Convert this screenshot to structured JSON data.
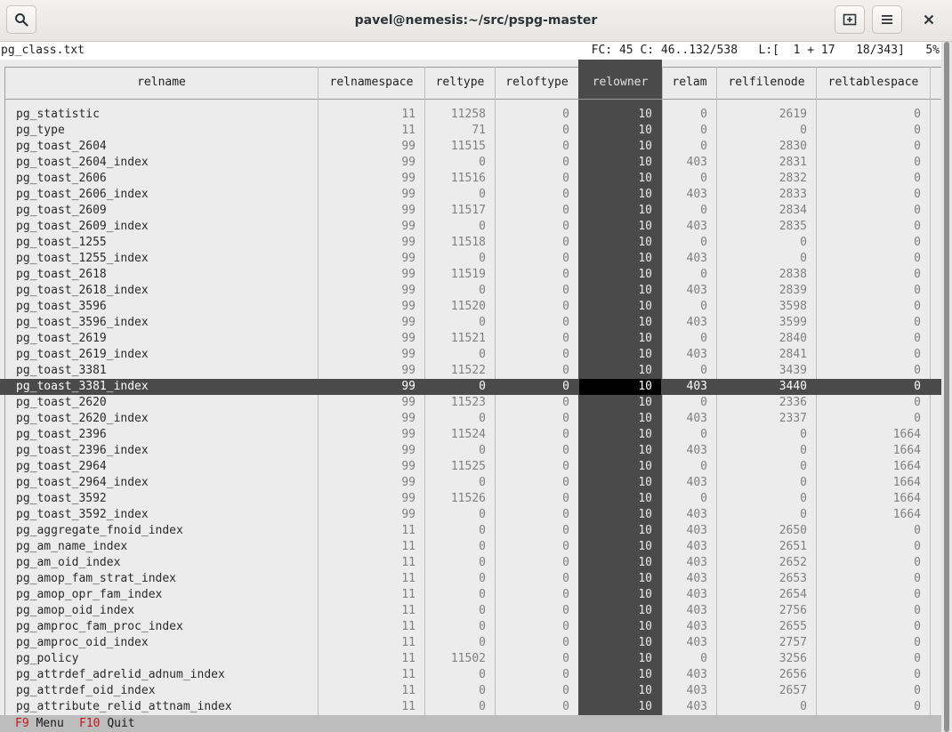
{
  "window": {
    "title": "pavel@nemesis:~/src/pspg-master",
    "search_icon": "search-icon",
    "new_tab_icon": "new-tab-icon",
    "menu_icon": "hamburger-menu-icon",
    "close_icon": "close-icon"
  },
  "status": {
    "filename": "pg_class.txt",
    "position": "FC: 45 C: 46..132/538   L:[  1 + 17   18/343]   5%"
  },
  "colors": {
    "cursor_row": "#4a4a4a",
    "highlighted_column": "#4a4a4a",
    "function_key": "#c01818"
  },
  "table": {
    "columns": [
      "relname",
      "relnamespace",
      "reltype",
      "reloftype",
      "relowner",
      "relam",
      "relfilenode",
      "reltablespace"
    ],
    "cursor_row_index": 17,
    "highlighted_column": "relowner",
    "rows": [
      [
        "pg_statistic",
        "11",
        "11258",
        "0",
        "10",
        "0",
        "2619",
        "0"
      ],
      [
        "pg_type",
        "11",
        "71",
        "0",
        "10",
        "0",
        "0",
        "0"
      ],
      [
        "pg_toast_2604",
        "99",
        "11515",
        "0",
        "10",
        "0",
        "2830",
        "0"
      ],
      [
        "pg_toast_2604_index",
        "99",
        "0",
        "0",
        "10",
        "403",
        "2831",
        "0"
      ],
      [
        "pg_toast_2606",
        "99",
        "11516",
        "0",
        "10",
        "0",
        "2832",
        "0"
      ],
      [
        "pg_toast_2606_index",
        "99",
        "0",
        "0",
        "10",
        "403",
        "2833",
        "0"
      ],
      [
        "pg_toast_2609",
        "99",
        "11517",
        "0",
        "10",
        "0",
        "2834",
        "0"
      ],
      [
        "pg_toast_2609_index",
        "99",
        "0",
        "0",
        "10",
        "403",
        "2835",
        "0"
      ],
      [
        "pg_toast_1255",
        "99",
        "11518",
        "0",
        "10",
        "0",
        "0",
        "0"
      ],
      [
        "pg_toast_1255_index",
        "99",
        "0",
        "0",
        "10",
        "403",
        "0",
        "0"
      ],
      [
        "pg_toast_2618",
        "99",
        "11519",
        "0",
        "10",
        "0",
        "2838",
        "0"
      ],
      [
        "pg_toast_2618_index",
        "99",
        "0",
        "0",
        "10",
        "403",
        "2839",
        "0"
      ],
      [
        "pg_toast_3596",
        "99",
        "11520",
        "0",
        "10",
        "0",
        "3598",
        "0"
      ],
      [
        "pg_toast_3596_index",
        "99",
        "0",
        "0",
        "10",
        "403",
        "3599",
        "0"
      ],
      [
        "pg_toast_2619",
        "99",
        "11521",
        "0",
        "10",
        "0",
        "2840",
        "0"
      ],
      [
        "pg_toast_2619_index",
        "99",
        "0",
        "0",
        "10",
        "403",
        "2841",
        "0"
      ],
      [
        "pg_toast_3381",
        "99",
        "11522",
        "0",
        "10",
        "0",
        "3439",
        "0"
      ],
      [
        "pg_toast_3381_index",
        "99",
        "0",
        "0",
        "10",
        "403",
        "3440",
        "0"
      ],
      [
        "pg_toast_2620",
        "99",
        "11523",
        "0",
        "10",
        "0",
        "2336",
        "0"
      ],
      [
        "pg_toast_2620_index",
        "99",
        "0",
        "0",
        "10",
        "403",
        "2337",
        "0"
      ],
      [
        "pg_toast_2396",
        "99",
        "11524",
        "0",
        "10",
        "0",
        "0",
        "1664"
      ],
      [
        "pg_toast_2396_index",
        "99",
        "0",
        "0",
        "10",
        "403",
        "0",
        "1664"
      ],
      [
        "pg_toast_2964",
        "99",
        "11525",
        "0",
        "10",
        "0",
        "0",
        "1664"
      ],
      [
        "pg_toast_2964_index",
        "99",
        "0",
        "0",
        "10",
        "403",
        "0",
        "1664"
      ],
      [
        "pg_toast_3592",
        "99",
        "11526",
        "0",
        "10",
        "0",
        "0",
        "1664"
      ],
      [
        "pg_toast_3592_index",
        "99",
        "0",
        "0",
        "10",
        "403",
        "0",
        "1664"
      ],
      [
        "pg_aggregate_fnoid_index",
        "11",
        "0",
        "0",
        "10",
        "403",
        "2650",
        "0"
      ],
      [
        "pg_am_name_index",
        "11",
        "0",
        "0",
        "10",
        "403",
        "2651",
        "0"
      ],
      [
        "pg_am_oid_index",
        "11",
        "0",
        "0",
        "10",
        "403",
        "2652",
        "0"
      ],
      [
        "pg_amop_fam_strat_index",
        "11",
        "0",
        "0",
        "10",
        "403",
        "2653",
        "0"
      ],
      [
        "pg_amop_opr_fam_index",
        "11",
        "0",
        "0",
        "10",
        "403",
        "2654",
        "0"
      ],
      [
        "pg_amop_oid_index",
        "11",
        "0",
        "0",
        "10",
        "403",
        "2756",
        "0"
      ],
      [
        "pg_amproc_fam_proc_index",
        "11",
        "0",
        "0",
        "10",
        "403",
        "2655",
        "0"
      ],
      [
        "pg_amproc_oid_index",
        "11",
        "0",
        "0",
        "10",
        "403",
        "2757",
        "0"
      ],
      [
        "pg_policy",
        "11",
        "11502",
        "0",
        "10",
        "0",
        "3256",
        "0"
      ],
      [
        "pg_attrdef_adrelid_adnum_index",
        "11",
        "0",
        "0",
        "10",
        "403",
        "2656",
        "0"
      ],
      [
        "pg_attrdef_oid_index",
        "11",
        "0",
        "0",
        "10",
        "403",
        "2657",
        "0"
      ],
      [
        "pg_attribute_relid_attnam_index",
        "11",
        "0",
        "0",
        "10",
        "403",
        "0",
        "0"
      ]
    ]
  },
  "bottom": {
    "key1": "F9",
    "label1": "Menu",
    "key2": "F10",
    "label2": "Quit"
  }
}
